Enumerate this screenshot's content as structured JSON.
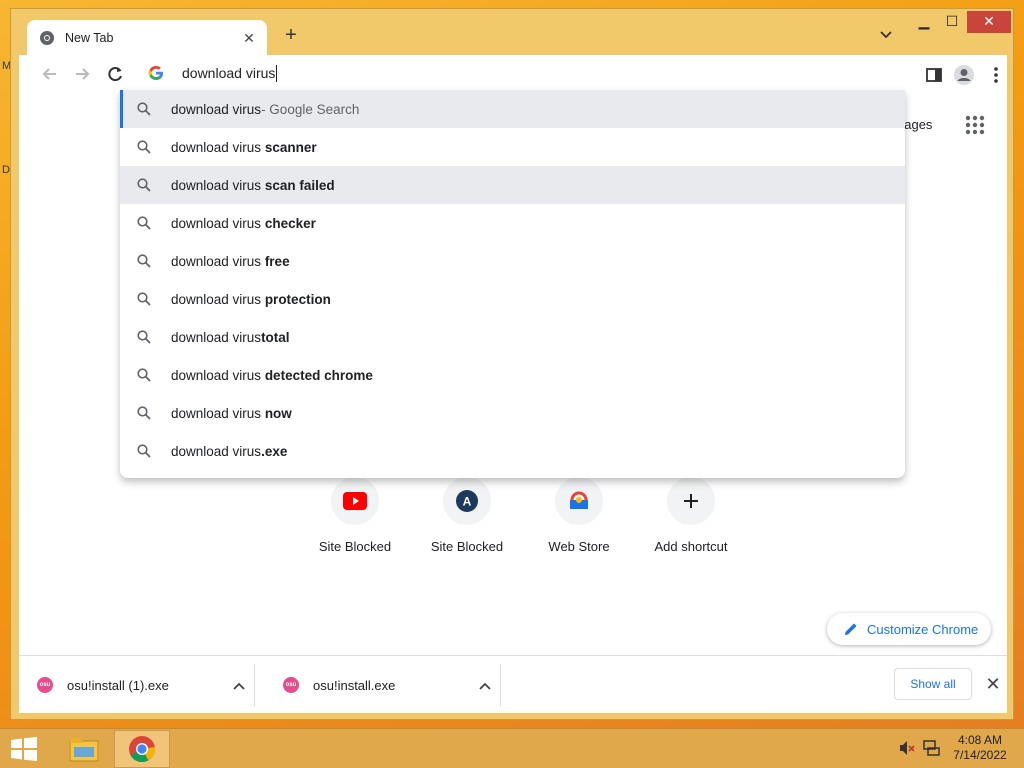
{
  "window": {
    "tab_title": "New Tab",
    "controls": [
      "minimize",
      "maximize",
      "close"
    ]
  },
  "omnibox": {
    "text": "download virus"
  },
  "suggestions": [
    {
      "prefix": "download virus",
      "suffix": "",
      "gray": " - Google Search",
      "selected": true
    },
    {
      "prefix": "download virus ",
      "suffix": "scanner",
      "gray": ""
    },
    {
      "prefix": "download virus ",
      "suffix": "scan failed",
      "gray": "",
      "hover": true
    },
    {
      "prefix": "download virus ",
      "suffix": "checker",
      "gray": ""
    },
    {
      "prefix": "download virus ",
      "suffix": "free",
      "gray": ""
    },
    {
      "prefix": "download virus ",
      "suffix": "protection",
      "gray": ""
    },
    {
      "prefix": "download virus",
      "suffix": "total",
      "gray": ""
    },
    {
      "prefix": "download virus ",
      "suffix": "detected chrome",
      "gray": ""
    },
    {
      "prefix": "download virus ",
      "suffix": "now",
      "gray": ""
    },
    {
      "prefix": "download virus",
      "suffix": ".exe",
      "gray": ""
    }
  ],
  "page": {
    "images_link": "nages",
    "shortcuts": [
      {
        "label": "Site Blocked",
        "icon": "youtube-icon"
      },
      {
        "label": "Site Blocked",
        "icon": "a-letter-icon"
      },
      {
        "label": "Web Store",
        "icon": "chrome-webstore-icon"
      },
      {
        "label": "Add shortcut",
        "icon": "plus-icon"
      }
    ],
    "customize_label": "Customize Chrome"
  },
  "downloads": {
    "items": [
      {
        "name": "osu!install (1).exe"
      },
      {
        "name": "osu!install.exe"
      }
    ],
    "show_all": "Show all"
  },
  "taskbar": {
    "time": "4:08 AM",
    "date": "7/14/2022"
  },
  "desktop": {
    "letters": [
      "M",
      "D"
    ]
  },
  "colors": {
    "accent": "#1a73e8",
    "window_frame": "#f2c96a",
    "taskbar": "#e0a84a"
  }
}
